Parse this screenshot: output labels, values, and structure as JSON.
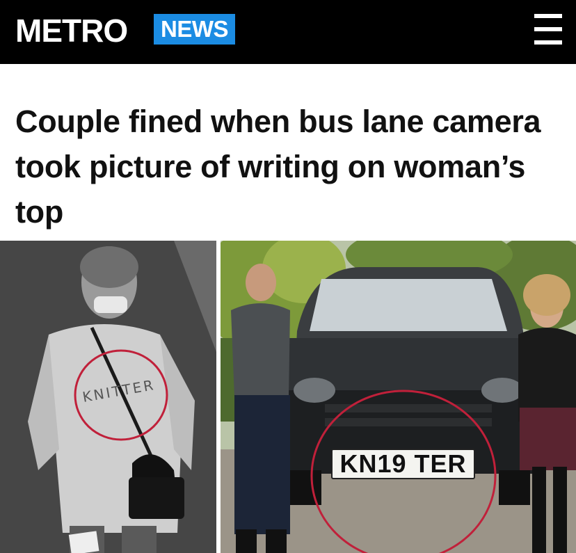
{
  "header": {
    "logo_text": "METRO",
    "section_label": "NEWS",
    "menu_icon": "hamburger-menu-icon",
    "background_color": "#000000",
    "badge_color": "#1b8ce3"
  },
  "article": {
    "headline": "Couple fined when bus lane camera took picture of writing on woman’s top"
  },
  "images": {
    "left_shirt_text": "KNITTER",
    "right_plate_text": "KN19 TER",
    "highlight_color": "#c0203a"
  }
}
